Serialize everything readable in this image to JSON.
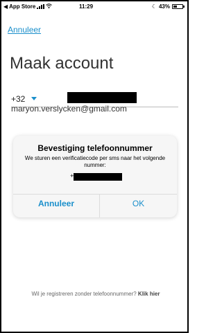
{
  "status_bar": {
    "back_label": "◀ App Store",
    "time": "11:29",
    "battery_text": "43%",
    "battery_level": 0.43
  },
  "nav": {
    "cancel_label": "Annuleer"
  },
  "page": {
    "title": "Maak account",
    "country_code": "+32",
    "email_value": "maryon.verslycken@gmail.com"
  },
  "alert": {
    "title": "Bevestiging telefoonnummer",
    "message": "We sturen een verificatiecode per sms naar het volgende nummer:",
    "number_prefix": "+",
    "cancel_label": "Annuleer",
    "ok_label": "OK"
  },
  "footer": {
    "text": "Wil je registreren zonder telefoonnummer?",
    "link_label": "Klik hier"
  },
  "colors": {
    "accent": "#1a8fcb",
    "alert_bg": "#f6f6f6"
  }
}
